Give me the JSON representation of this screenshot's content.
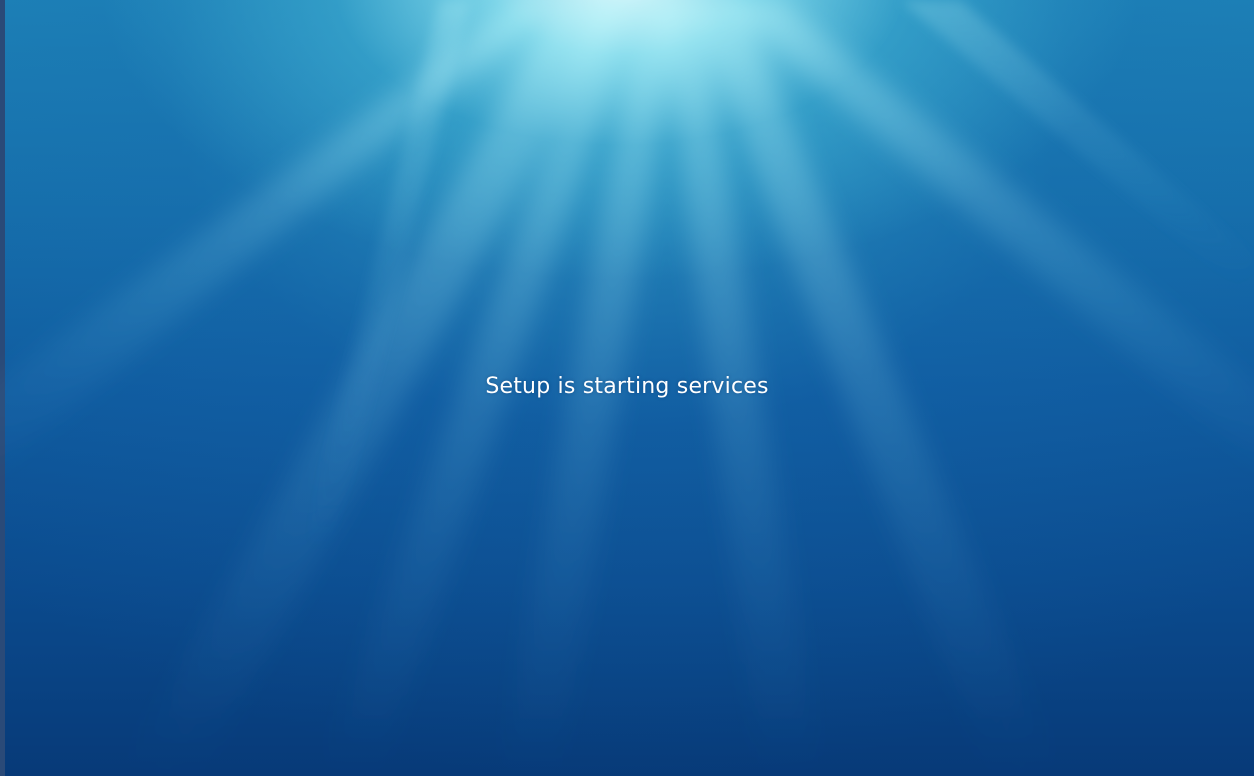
{
  "setup": {
    "status_message": "Setup is starting services"
  },
  "colors": {
    "glow": "#e6ffff",
    "background_top": "#1d82b6",
    "background_bottom": "#073a78",
    "text": "#ffffff"
  }
}
